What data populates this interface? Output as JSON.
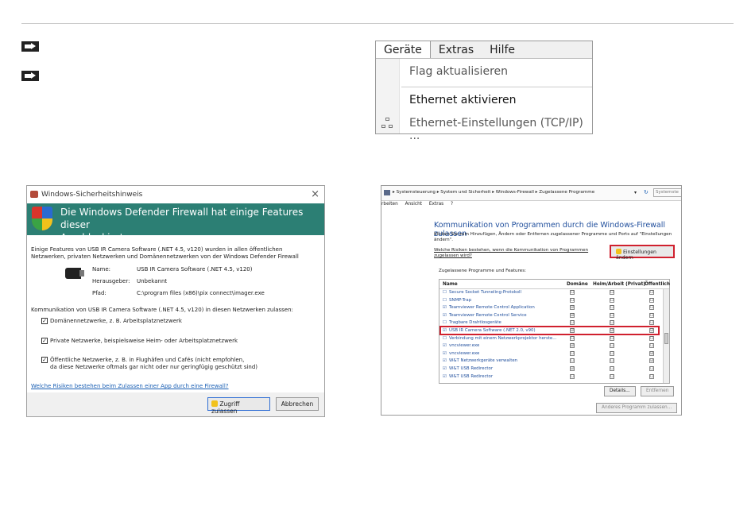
{
  "menu": {
    "bar": [
      "Geräte",
      "Extras",
      "Hilfe"
    ],
    "items": [
      "Flag aktualisieren",
      "Ethernet aktivieren",
      "Ethernet-Einstellungen (TCP/IP) ..."
    ]
  },
  "dialog": {
    "title": "Windows-Sicherheitshinweis",
    "close": "×",
    "heading_line1": "Die Windows Defender Firewall hat einige Features dieser",
    "heading_line2": "App blockiert.",
    "intro_line1": "Einige Features von USB IR Camera Software (.NET 4.5, v120) wurden in allen öffentlichen",
    "intro_line2": "Netzwerken, privaten Netzwerken und Domänennetzwerken von der Windows Defender Firewall",
    "name_label": "Name:",
    "name_value": "USB IR Camera Software (.NET 4.5, v120)",
    "publisher_label": "Herausgeber:",
    "publisher_value": "Unbekannt",
    "path_label": "Pfad:",
    "path_value": "C:\\program files (x86)\\pix connect\\imager.exe",
    "allow_text": "Kommunikation von USB IR Camera Software (.NET 4.5, v120) in diesen Netzwerken zulassen:",
    "cb_domain": "Domänennetzwerke, z. B. Arbeitsplatznetzwerk",
    "cb_private": "Private Netzwerke, beispielsweise Heim- oder Arbeitsplatznetzwerk",
    "cb_public_line1": "Öffentliche Netzwerke, z. B. in Flughäfen und Cafés (nicht empfohlen,",
    "cb_public_line2": "da diese Netzwerke oftmals gar nicht oder nur geringfügig geschützt sind)",
    "risk_link": "Welche Risiken bestehen beim Zulassen einer App durch eine Firewall?",
    "allow_button": "Zugriff zulassen",
    "cancel_button": "Abbrechen"
  },
  "firewall": {
    "breadcrumb": "▸ Systemsteuerung ▸ System und Sicherheit ▸ Windows-Firewall ▸ Zugelassene Programme",
    "search": "Systemste",
    "menu": [
      "rbeiten",
      "Ansicht",
      "Extras",
      "?"
    ],
    "heading": "Kommunikation von Programmen durch die Windows-Firewall zulassen",
    "desc_line1": "Klicken Sie zum Hinzufügen, Ändern oder Entfernen zugelassener Programme und Ports auf \"Einstellungen",
    "desc_line2": "ändern\".",
    "risk_line1": "Welche Risiken bestehen, wenn die Kommunikation von Programmen",
    "risk_line2": "zugelassen wird?",
    "settings_button": "Einstellungen ändern",
    "group_label": "Zugelassene Programme und Features:",
    "col_name": "Name",
    "col_domain": "Domäne",
    "col_home": "Heim/Arbeit (Privat)",
    "col_public": "Öffentlich",
    "rows": [
      {
        "name": "Secure Socket Tunneling-Protokoll",
        "cb": "☐",
        "d": "☐",
        "h": "☐",
        "p": "☐"
      },
      {
        "name": "SNMP-Trap",
        "cb": "☐",
        "d": "☐",
        "h": "☐",
        "p": "☐"
      },
      {
        "name": "Teamviewer Remote Control Application",
        "cb": "☑",
        "d": "☑",
        "h": "☐",
        "p": "☐"
      },
      {
        "name": "Teamviewer Remote Control Service",
        "cb": "☑",
        "d": "☑",
        "h": "☐",
        "p": "☐"
      },
      {
        "name": "Tragbare Drahtlosgeräte",
        "cb": "☐",
        "d": "☐",
        "h": "☐",
        "p": "☐"
      },
      {
        "name": "USB IR Camera Software (.NET 2.0, v90)",
        "cb": "☑",
        "d": "☑",
        "h": "☑",
        "p": "☑"
      },
      {
        "name": "Verbindung mit einem Netzwerkprojektor herste...",
        "cb": "☐",
        "d": "☐",
        "h": "☐",
        "p": "☐"
      },
      {
        "name": "vncviewer.exe",
        "cb": "☑",
        "d": "☑",
        "h": "☐",
        "p": "☐"
      },
      {
        "name": "vncviewer.exe",
        "cb": "☑",
        "d": "☐",
        "h": "☐",
        "p": "☑"
      },
      {
        "name": "W&T Netzwerkgeräte verwalten",
        "cb": "☑",
        "d": "☐",
        "h": "☐",
        "p": "☑"
      },
      {
        "name": "W&T USB Redirector",
        "cb": "☑",
        "d": "☑",
        "h": "☐",
        "p": "☐"
      },
      {
        "name": "W&T USB Redirector",
        "cb": "☑",
        "d": "☐",
        "h": "☐",
        "p": "☐"
      }
    ],
    "details_button": "Details...",
    "remove_button": "Entfernen",
    "add_button": "Anderes Programm zulassen..."
  }
}
